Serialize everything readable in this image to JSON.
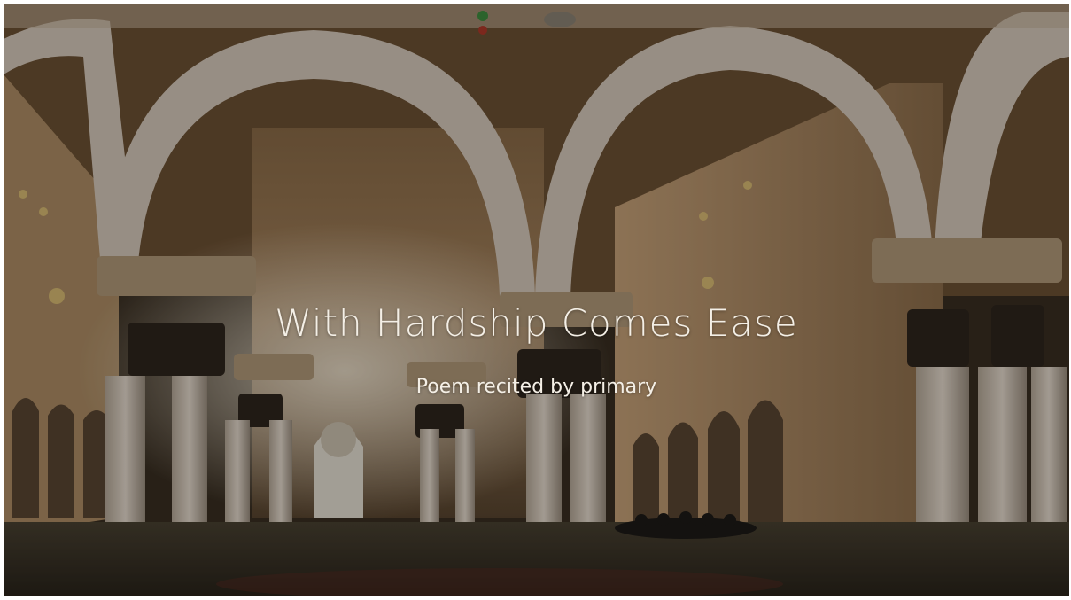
{
  "slide": {
    "title": "With Hardship Comes Ease",
    "subtitle": "Poem recited by primary"
  },
  "background": {
    "subject": "mosque-interior-arches-icon",
    "palette": {
      "wall": "#c9a883",
      "arch": "#d8cbbc",
      "ceiling": "#7a5e40",
      "floor": "#3b3427",
      "shadow": "#231d16",
      "glow": "#f3e2c6"
    }
  }
}
